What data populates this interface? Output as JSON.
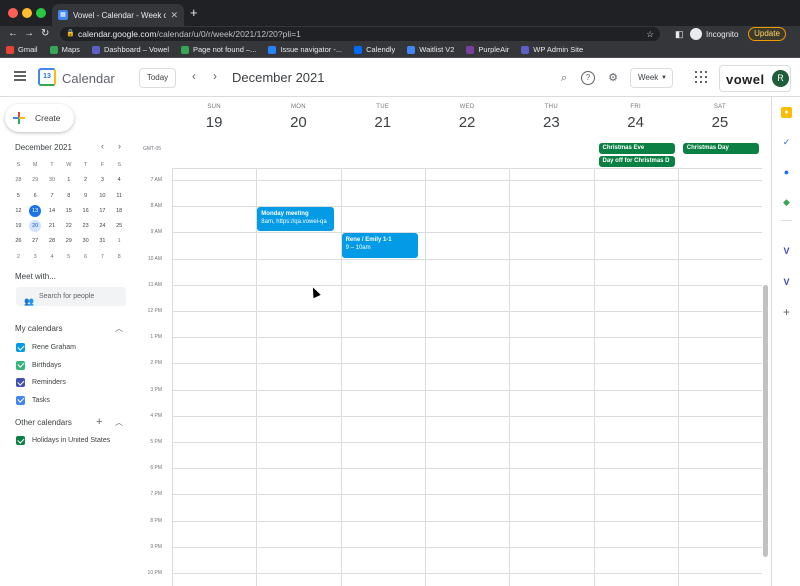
{
  "browser": {
    "tab_title": "Vowel - Calendar - Week of De",
    "url_host": "calendar.google.com",
    "url_path": "/calendar/u/0/r/week/2021/12/20?pli=1",
    "incognito_label": "Incognito",
    "update_label": "Update",
    "bookmarks": [
      {
        "label": "Gmail",
        "color": "#ea4335"
      },
      {
        "label": "Maps",
        "color": "#34a853"
      },
      {
        "label": "Dashboard – Vowel",
        "color": "#5b5fc7"
      },
      {
        "label": "Page not found –...",
        "color": "#34a853"
      },
      {
        "label": "Issue navigator -...",
        "color": "#2684ff"
      },
      {
        "label": "Calendly",
        "color": "#006bff"
      },
      {
        "label": "Waitlist V2",
        "color": "#4285f4"
      },
      {
        "label": "PurpleAir",
        "color": "#7b3fa0"
      },
      {
        "label": "WP Admin Site",
        "color": "#5b5fc7"
      }
    ]
  },
  "header": {
    "app_name": "Calendar",
    "logo_number": "13",
    "today_label": "Today",
    "period": "December 2021",
    "view": "Week",
    "brand": "vowel",
    "avatar_letter": "R"
  },
  "sidebar": {
    "create_label": "Create",
    "mini_month": "December 2021",
    "weekday_heads": [
      "S",
      "M",
      "T",
      "W",
      "T",
      "F",
      "S"
    ],
    "weeks": [
      [
        {
          "d": "28",
          "m": true
        },
        {
          "d": "29",
          "m": true
        },
        {
          "d": "30",
          "m": true
        },
        {
          "d": "1"
        },
        {
          "d": "2"
        },
        {
          "d": "3"
        },
        {
          "d": "4"
        }
      ],
      [
        {
          "d": "5"
        },
        {
          "d": "6"
        },
        {
          "d": "7"
        },
        {
          "d": "8"
        },
        {
          "d": "9"
        },
        {
          "d": "10"
        },
        {
          "d": "11"
        }
      ],
      [
        {
          "d": "12"
        },
        {
          "d": "13",
          "today": true
        },
        {
          "d": "14"
        },
        {
          "d": "15"
        },
        {
          "d": "16"
        },
        {
          "d": "17"
        },
        {
          "d": "18"
        }
      ],
      [
        {
          "d": "19"
        },
        {
          "d": "20",
          "sel": true
        },
        {
          "d": "21"
        },
        {
          "d": "22"
        },
        {
          "d": "23"
        },
        {
          "d": "24"
        },
        {
          "d": "25"
        }
      ],
      [
        {
          "d": "26"
        },
        {
          "d": "27"
        },
        {
          "d": "28"
        },
        {
          "d": "29"
        },
        {
          "d": "30"
        },
        {
          "d": "31"
        },
        {
          "d": "1",
          "m": true
        }
      ],
      [
        {
          "d": "2",
          "m": true
        },
        {
          "d": "3",
          "m": true
        },
        {
          "d": "4",
          "m": true
        },
        {
          "d": "5",
          "m": true
        },
        {
          "d": "6",
          "m": true
        },
        {
          "d": "7",
          "m": true
        },
        {
          "d": "8",
          "m": true
        }
      ]
    ],
    "meet_with_label": "Meet with...",
    "search_people_placeholder": "Search for people",
    "my_calendars_label": "My calendars",
    "my_calendars": [
      {
        "label": "Rene Graham",
        "color": "#039be5"
      },
      {
        "label": "Birthdays",
        "color": "#33b679"
      },
      {
        "label": "Reminders",
        "color": "#3f51b5"
      },
      {
        "label": "Tasks",
        "color": "#4285f4"
      }
    ],
    "other_calendars_label": "Other calendars",
    "other_calendars": [
      {
        "label": "Holidays in United States",
        "color": "#0b8043"
      }
    ]
  },
  "week": {
    "timezone": "GMT-05",
    "days": [
      {
        "name": "SUN",
        "date": "19"
      },
      {
        "name": "MON",
        "date": "20"
      },
      {
        "name": "TUE",
        "date": "21"
      },
      {
        "name": "WED",
        "date": "22"
      },
      {
        "name": "THU",
        "date": "23"
      },
      {
        "name": "FRI",
        "date": "24"
      },
      {
        "name": "SAT",
        "date": "25"
      }
    ],
    "all_day_events": [
      {
        "title": "Christmas Eve",
        "day": 5,
        "slot": 0
      },
      {
        "title": "Day off for Christmas D",
        "day": 5,
        "slot": 1
      },
      {
        "title": "Christmas Day",
        "day": 6,
        "slot": 0
      }
    ],
    "time_labels": [
      "7 AM",
      "8 AM",
      "9 AM",
      "10 AM",
      "11 AM",
      "12 PM",
      "1 PM",
      "2 PM",
      "3 PM",
      "4 PM",
      "5 PM",
      "6 PM",
      "7 PM",
      "8 PM",
      "9 PM",
      "10 PM"
    ],
    "events": [
      {
        "title": "Monday meeting",
        "detail": "8am, https://qa.vowel-qa",
        "day": 1,
        "start": 8,
        "end": 9
      },
      {
        "title": "Rene / Emily 1-1",
        "detail": "9 – 10am",
        "day": 2,
        "start": 9,
        "end": 10
      }
    ]
  },
  "colors": {
    "accent": "#1a73e8",
    "event_blue": "#039be5",
    "holiday_green": "#0b8043"
  }
}
